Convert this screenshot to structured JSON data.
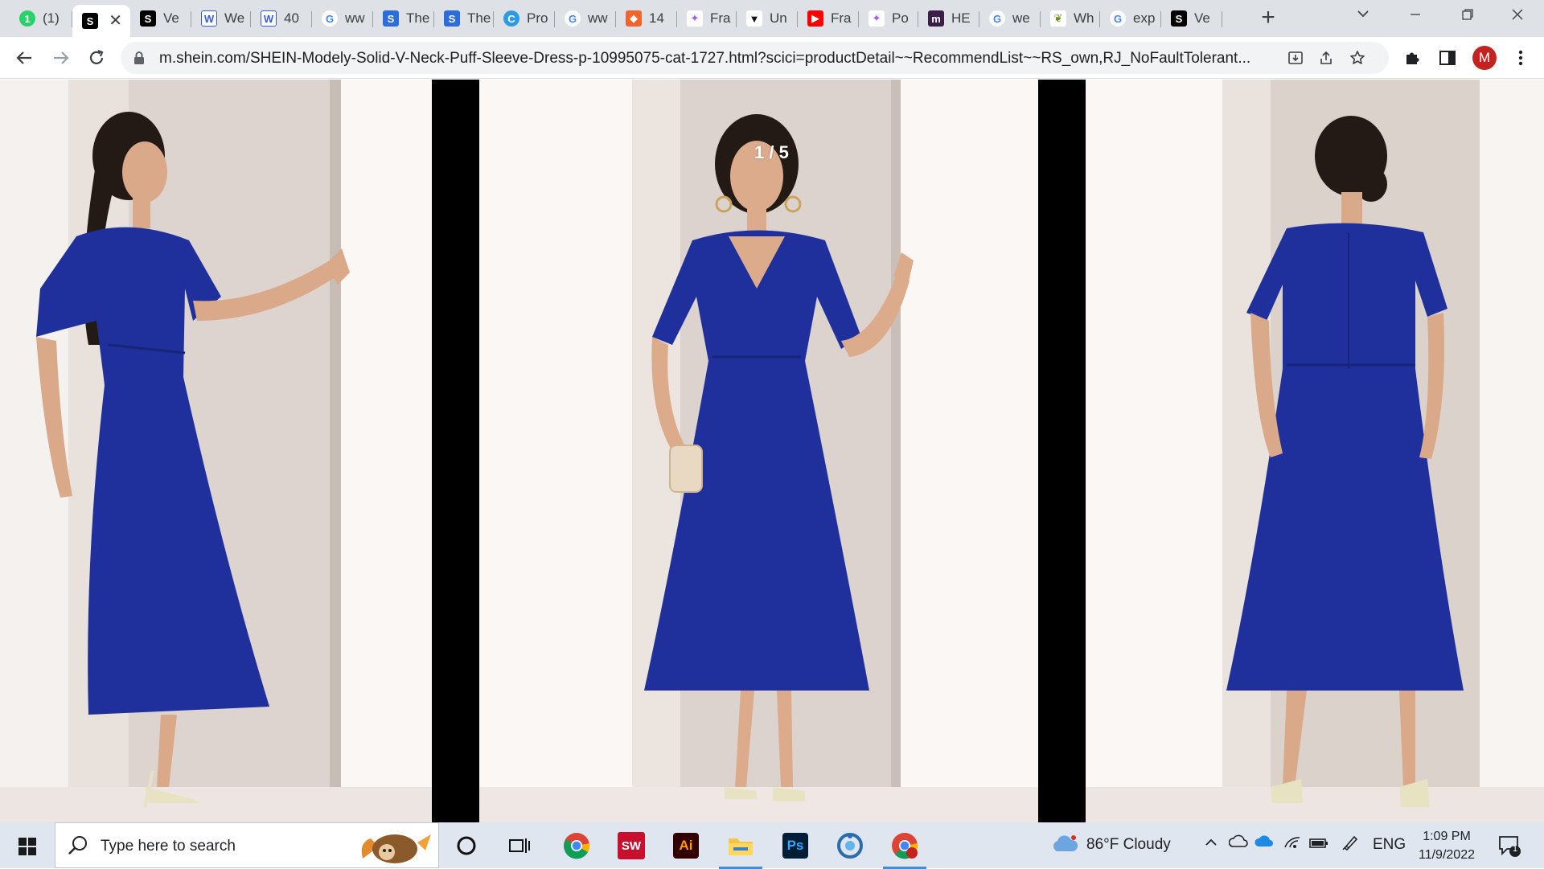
{
  "tabs": [
    {
      "label": "(1)",
      "icon": "whatsapp-icon",
      "color": "#25d366"
    },
    {
      "label": "",
      "icon": "shein-icon",
      "active": true
    },
    {
      "label": "Ve",
      "icon": "shein-icon"
    },
    {
      "label": "We",
      "icon": "word-w-icon"
    },
    {
      "label": "40",
      "icon": "word-w-icon"
    },
    {
      "label": "ww",
      "icon": "google-icon"
    },
    {
      "label": "The",
      "icon": "s-blue-icon"
    },
    {
      "label": "The",
      "icon": "s-blue-icon"
    },
    {
      "label": "Pro",
      "icon": "c-blue-icon"
    },
    {
      "label": "ww",
      "icon": "google-icon"
    },
    {
      "label": "14",
      "icon": "diamond-orange-icon"
    },
    {
      "label": "Fra",
      "icon": "figma-icon"
    },
    {
      "label": "Un",
      "icon": "framer-icon"
    },
    {
      "label": "Fra",
      "icon": "youtube-icon"
    },
    {
      "label": "Po",
      "icon": "figma-icon"
    },
    {
      "label": "HE",
      "icon": "m-purple-icon"
    },
    {
      "label": "we",
      "icon": "google-icon"
    },
    {
      "label": "Wh",
      "icon": "leaf-icon"
    },
    {
      "label": "exp",
      "icon": "google-icon"
    },
    {
      "label": "Ve",
      "icon": "shein-icon"
    }
  ],
  "address": {
    "url": "m.shein.com/SHEIN-Modely-Solid-V-Neck-Puff-Sleeve-Dress-p-10995075-cat-1727.html?scici=productDetail~~RecommendList~~RS_own,RJ_NoFaultTolerant..."
  },
  "profile": {
    "initial": "M"
  },
  "gallery": {
    "counter": "1 / 5",
    "dress_color": "#1f2f9c"
  },
  "taskbar": {
    "search_placeholder": "Type here to search",
    "weather": "86°F  Cloudy",
    "language": "ENG",
    "time": "1:09 PM",
    "date": "11/9/2022",
    "notifications": "1",
    "apps": [
      "cortana-icon",
      "task-view-icon",
      "chrome-icon",
      "solidworks-icon",
      "illustrator-icon",
      "file-explorer-icon",
      "photoshop-icon",
      "network-app-icon",
      "chrome-profile-icon"
    ],
    "solidworks_label": "SW",
    "illustrator_label": "Ai",
    "photoshop_label": "Ps"
  }
}
